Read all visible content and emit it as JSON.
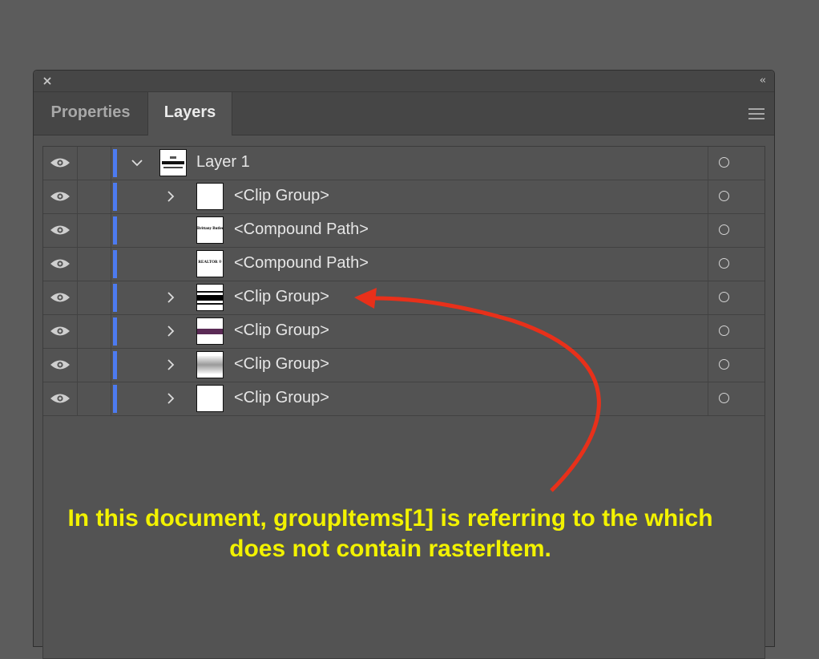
{
  "window": {
    "close_icon": "close-icon",
    "collapse_glyph": "‹‹"
  },
  "tabs": [
    {
      "label": "Properties",
      "active": false
    },
    {
      "label": "Layers",
      "active": true
    }
  ],
  "colors": {
    "layer_color_bar": "#4d7bf0",
    "annotation_text": "#f2f200",
    "annotation_arrow": "#e8301a"
  },
  "layers": [
    {
      "label": "Layer 1",
      "expanded": true,
      "visible": true
    },
    {
      "label": "<Clip Group>",
      "visible": true
    },
    {
      "label": "<Compound Path>",
      "visible": true,
      "thumb_text": "Brittany Butler"
    },
    {
      "label": "<Compound Path>",
      "visible": true,
      "thumb_text": "REALTOR ®"
    },
    {
      "label": "<Clip Group>",
      "visible": true
    },
    {
      "label": "<Clip Group>",
      "visible": true
    },
    {
      "label": "<Clip Group>",
      "visible": true
    },
    {
      "label": "<Clip Group>",
      "visible": true
    }
  ],
  "annotation": {
    "line1": "In this document, groupItems[1] is referring to the which",
    "line2": "does not contain rasterItem."
  }
}
